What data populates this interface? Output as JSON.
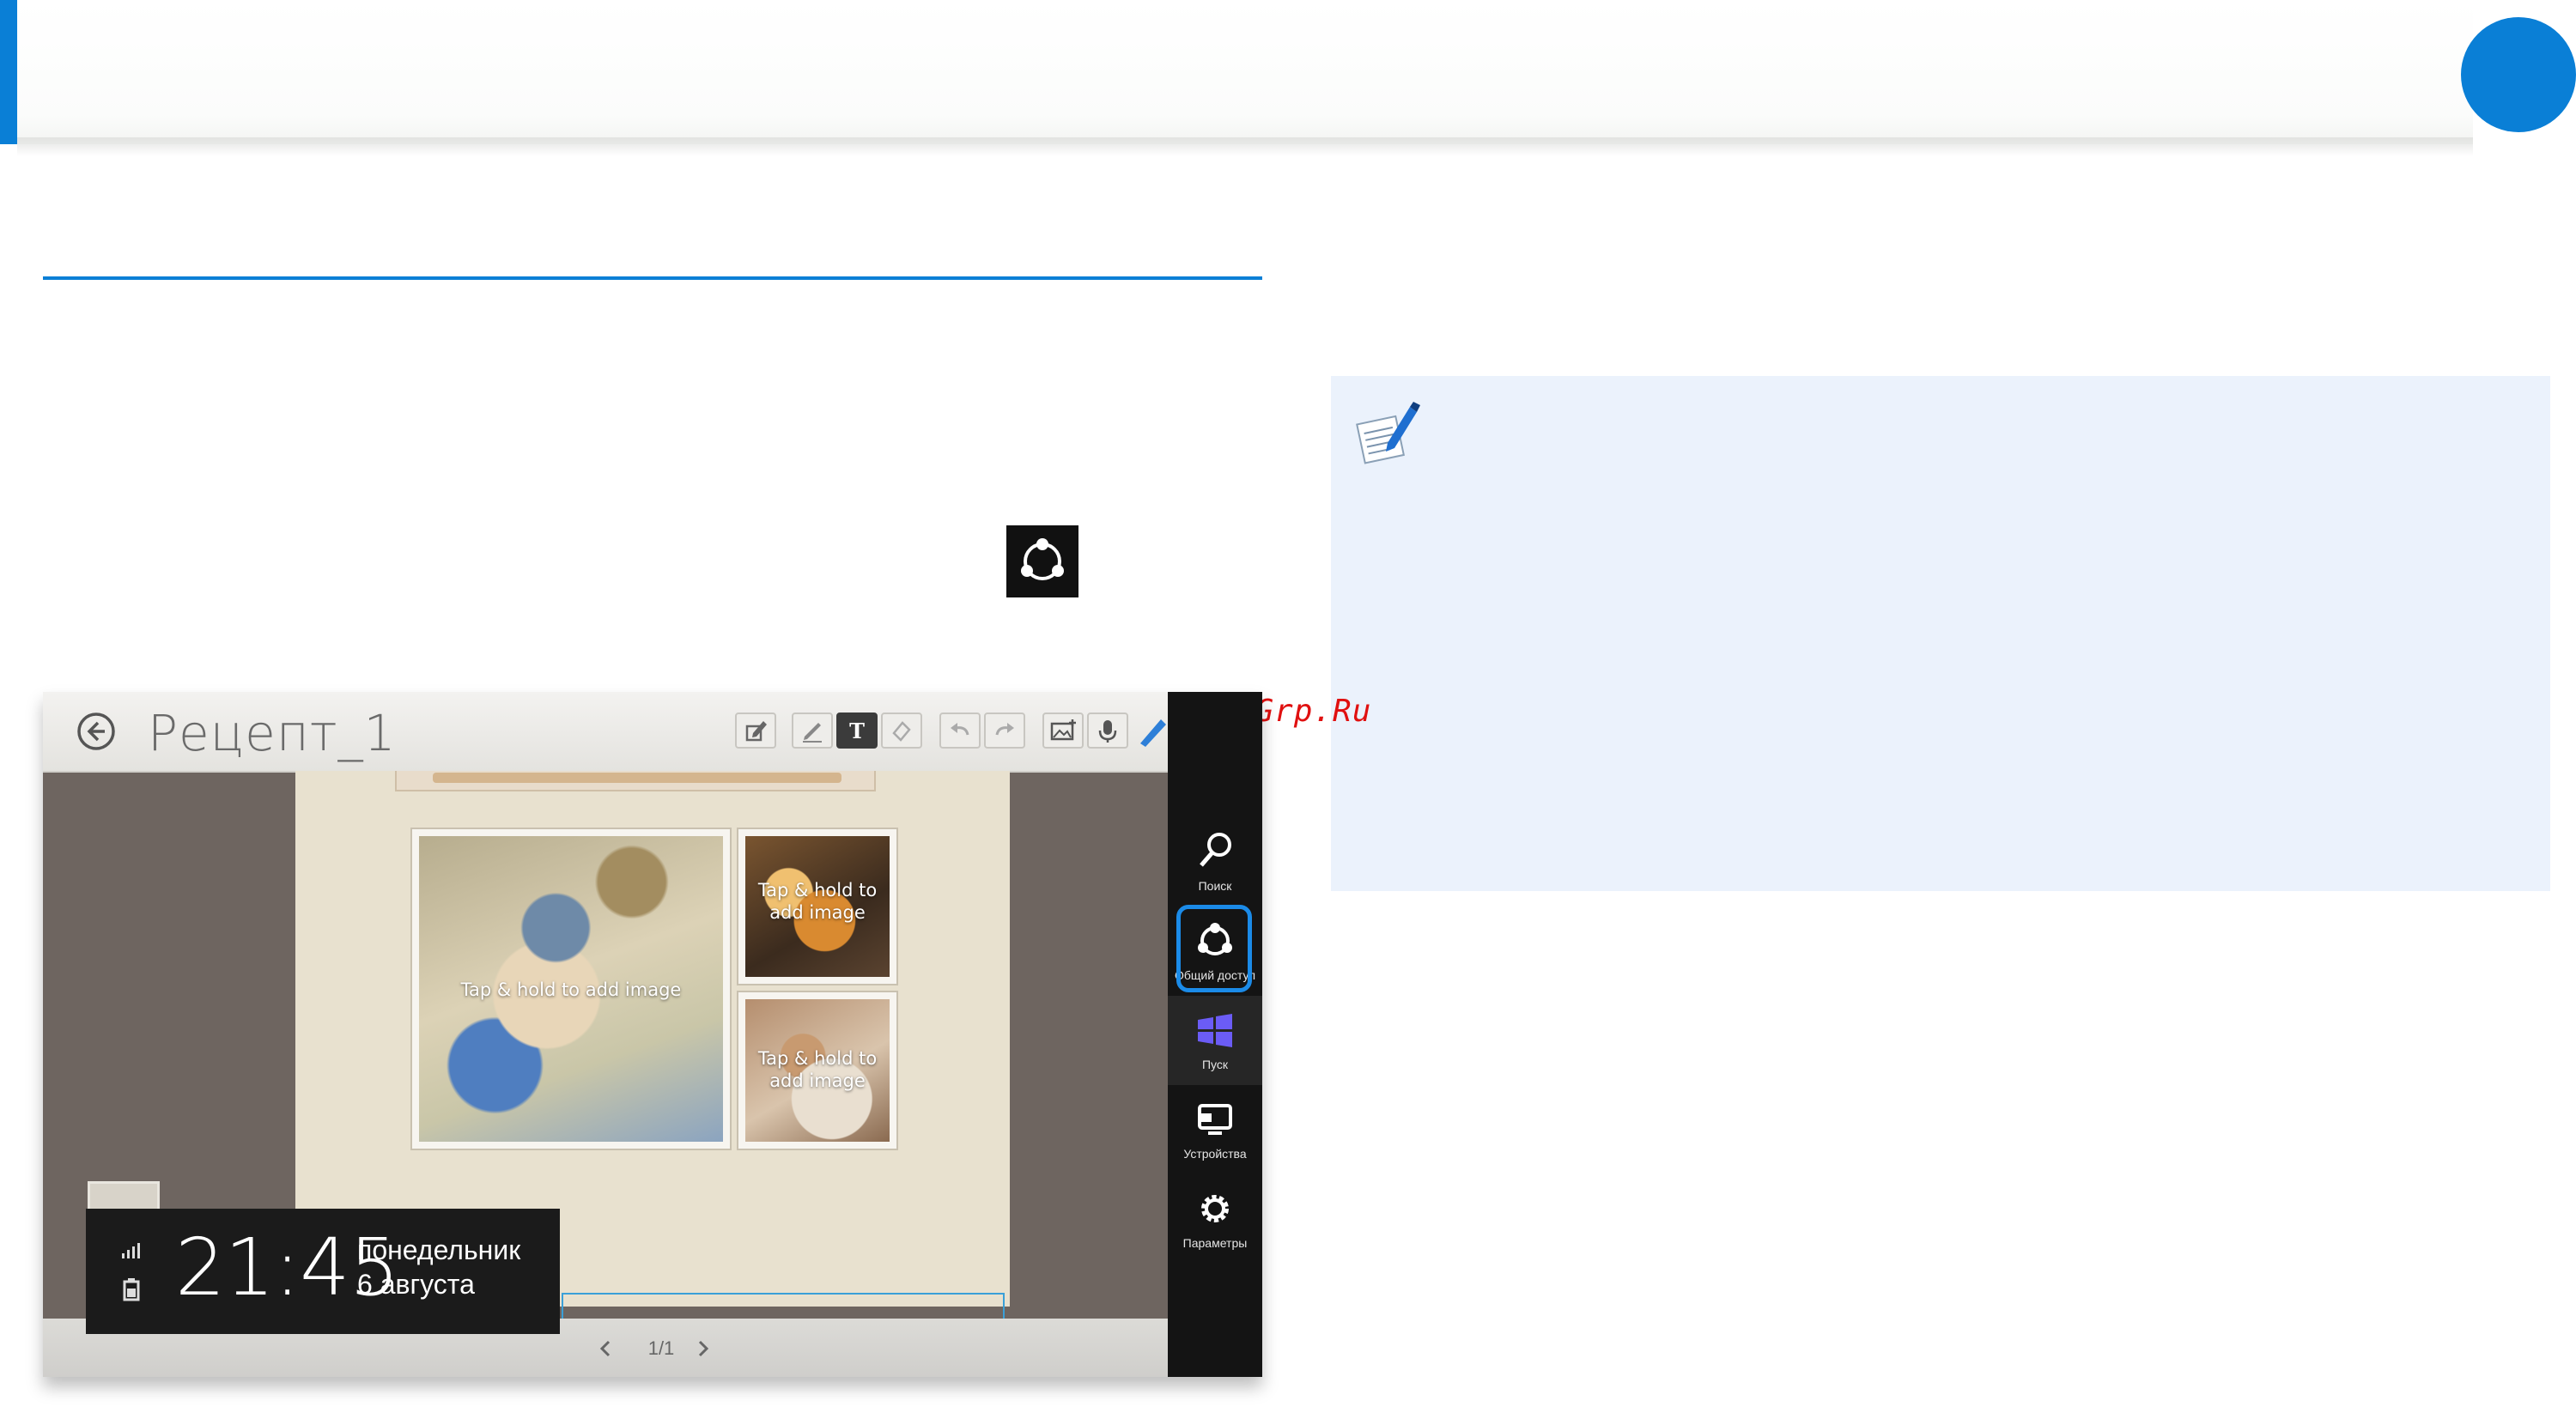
{
  "header": {
    "accent_color": "#0a7fd6"
  },
  "watermark": {
    "text": "McGrp.Ru"
  },
  "screenshot": {
    "document_title": "Рецепт_1",
    "photo_placeholder_text": "Tap & hold to add image",
    "photo_placeholder_small_line1": "Tap & hold to",
    "photo_placeholder_small_line2": "add image",
    "page_indicator": "1/1",
    "clock": {
      "time": "21:45",
      "weekday": "понедельник",
      "date": "6 августа"
    },
    "charms": [
      {
        "label": "Поиск",
        "icon": "search-icon"
      },
      {
        "label": "Общий доступ",
        "icon": "share-icon"
      },
      {
        "label": "Пуск",
        "icon": "windows-start-icon"
      },
      {
        "label": "Устройства",
        "icon": "devices-icon"
      },
      {
        "label": "Параметры",
        "icon": "gear-icon"
      }
    ],
    "highlight_color": "#1b8be8",
    "start_logo_color": "#6b5cf6"
  }
}
